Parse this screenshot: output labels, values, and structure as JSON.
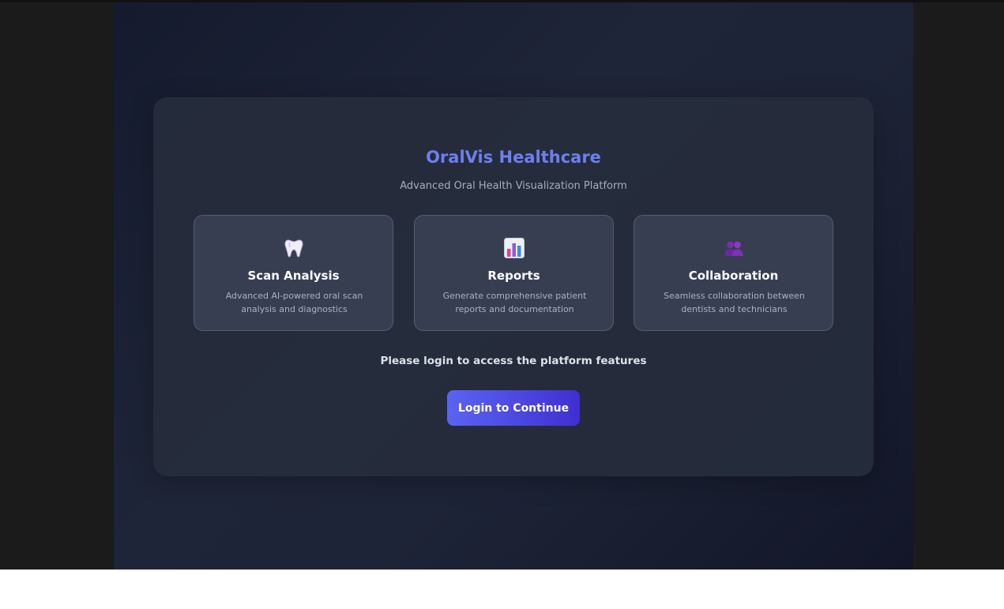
{
  "app": {
    "title": "OralVis Healthcare",
    "subtitle": "Advanced Oral Health Visualization Platform"
  },
  "features": [
    {
      "icon": "tooth-icon",
      "title": "Scan Analysis",
      "description": "Advanced AI-powered oral scan analysis and diagnostics"
    },
    {
      "icon": "bar-chart-icon",
      "title": "Reports",
      "description": "Generate comprehensive patient reports and documentation"
    },
    {
      "icon": "people-icon",
      "title": "Collaboration",
      "description": "Seamless collaboration between dentists and technicians"
    }
  ],
  "login": {
    "prompt": "Please login to access the platform features",
    "button_label": "Login to Continue"
  },
  "colors": {
    "accent": "#6b80f0",
    "button_start": "#5a64f2",
    "button_end": "#3f2fd2",
    "background": "#1e2437"
  }
}
